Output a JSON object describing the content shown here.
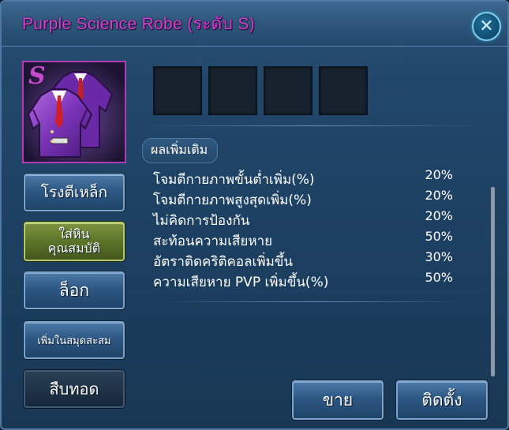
{
  "window": {
    "title": "Purple Science Robe (ระดับ S)",
    "close_icon": "close-icon"
  },
  "item": {
    "grade": "S",
    "icon": "purple-robe-icon",
    "slot_count": 4
  },
  "bonus": {
    "label": "ผลเพิ่มเติม",
    "stats": [
      {
        "name": "โจมตีกายภาพขั้นต่ำเพิ่ม(%)",
        "value": "20%"
      },
      {
        "name": "โจมตีกายภาพสูงสุดเพิ่ม(%)",
        "value": "20%"
      },
      {
        "name": "ไม่คิดการป้องกัน",
        "value": "20%"
      },
      {
        "name": "สะท้อนความเสียหาย",
        "value": "50%"
      },
      {
        "name": "อัตราติดคริติคอลเพิ่มขึ้น",
        "value": "30%"
      },
      {
        "name": "ความเสียหาย PVP เพิ่มขึ้น(%)",
        "value": "50%"
      }
    ]
  },
  "side_buttons": {
    "forge": "โรงตีเหล็ก",
    "socket_line1": "ใส่หิน",
    "socket_line2": "คุณสมบัติ",
    "lock": "ล็อก",
    "collection": "เพิ่มในสมุดสะสม",
    "inherit": "สืบทอด"
  },
  "actions": {
    "sell": "ขาย",
    "equip": "ติดตั้ง"
  },
  "colors": {
    "title": "#d63fd2",
    "grade_border": "#b43ab5",
    "panel": "#1c3f60"
  }
}
